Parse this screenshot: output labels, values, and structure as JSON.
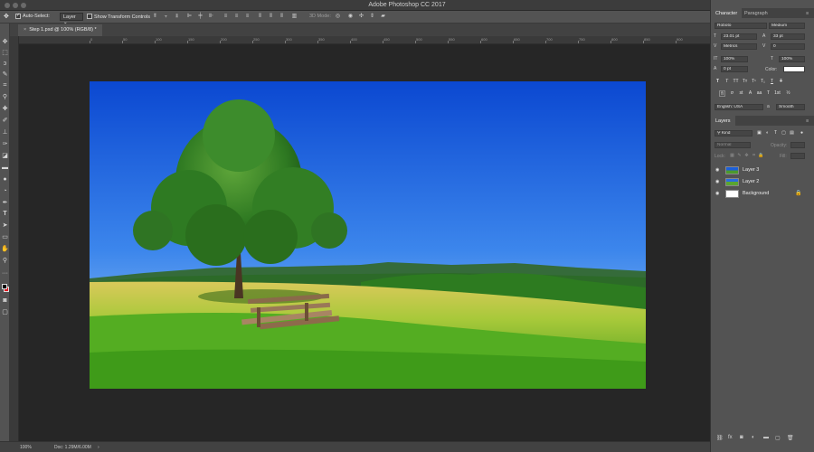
{
  "window": {
    "title": "Adobe Photoshop CC 2017"
  },
  "options_bar": {
    "auto_select_label": "Auto-Select:",
    "auto_select_value": "Layer",
    "transform_label": "Show Transform Controls",
    "mode_label": "3D Mode:"
  },
  "toolbar": {
    "tools": [
      "move-icon",
      "marquee-icon",
      "lasso-icon",
      "quick-select-icon",
      "crop-icon",
      "eyedropper-icon",
      "healing-icon",
      "brush-icon",
      "stamp-icon",
      "history-brush-icon",
      "eraser-icon",
      "gradient-icon",
      "blur-icon",
      "dodge-icon",
      "pen-icon",
      "type-icon",
      "path-select-icon",
      "shape-icon",
      "hand-icon",
      "zoom-icon"
    ]
  },
  "document": {
    "tab_label": "Step 1.psd @ 100% (RGB/8) *",
    "ruler_top": [
      "0",
      "50",
      "100",
      "150",
      "200",
      "250",
      "300",
      "350",
      "400",
      "450",
      "500",
      "550",
      "600",
      "650",
      "700",
      "750",
      "800",
      "850",
      "900",
      "950",
      "1000"
    ]
  },
  "status": {
    "zoom": "100%",
    "doc": "Doc: 1.29M/6.00M"
  },
  "character_panel": {
    "tabs": [
      "Character",
      "Paragraph"
    ],
    "font_family": "Roboto",
    "font_style": "Medium",
    "font_size": "23.01 pt",
    "leading": "33 pt",
    "kerning": "Metrics",
    "tracking": "0",
    "vertical_scale": "100%",
    "horizontal_scale": "100%",
    "baseline_shift": "0 pt",
    "color_label": "Color:",
    "language": "English: USA",
    "aa_label": "a",
    "antialias": "Smooth"
  },
  "layers_panel": {
    "tab": "Layers",
    "filter": "Kind",
    "blend_mode": "Normal",
    "opacity_label": "Opacity:",
    "lock_label": "Lock:",
    "fill_label": "Fill:",
    "layers": [
      {
        "name": "Layer 3",
        "visible": true
      },
      {
        "name": "Layer 2",
        "visible": true
      },
      {
        "name": "Background",
        "visible": true,
        "locked": true
      }
    ]
  },
  "colors": {
    "foreground": "#000000",
    "background_swatch": "#e0141e"
  }
}
